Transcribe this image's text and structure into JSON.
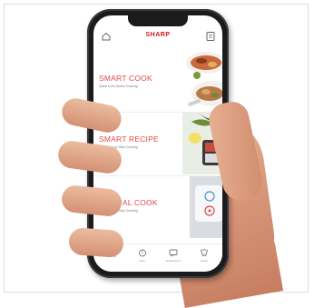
{
  "app": {
    "brand": "SHARP"
  },
  "topbar": {
    "left_icon": "home-outline-icon",
    "right_icon": "menu-icon"
  },
  "cards": [
    {
      "title": "SMART COOK",
      "subtitle": "Quick & No Guess Cooking",
      "image": "food-plate-photo"
    },
    {
      "title": "SMART RECIPE",
      "subtitle": "Easy Step by Step Cooking",
      "image": "recipe-photo"
    },
    {
      "title": "MANUAL COOK",
      "subtitle": "Easy Step by Step Cooking",
      "image": "control-panel-photo"
    }
  ],
  "bottomnav": {
    "items": [
      {
        "label": "",
        "icon": "home-icon"
      },
      {
        "label": "Alarm",
        "icon": "alarm-icon"
      },
      {
        "label": "Notifications",
        "icon": "message-icon"
      },
      {
        "label": "Guide",
        "icon": "chef-hat-icon"
      }
    ]
  },
  "colors": {
    "brand_red": "#d4141f",
    "title_red": "#e04848",
    "accent_home": "#e04848"
  }
}
